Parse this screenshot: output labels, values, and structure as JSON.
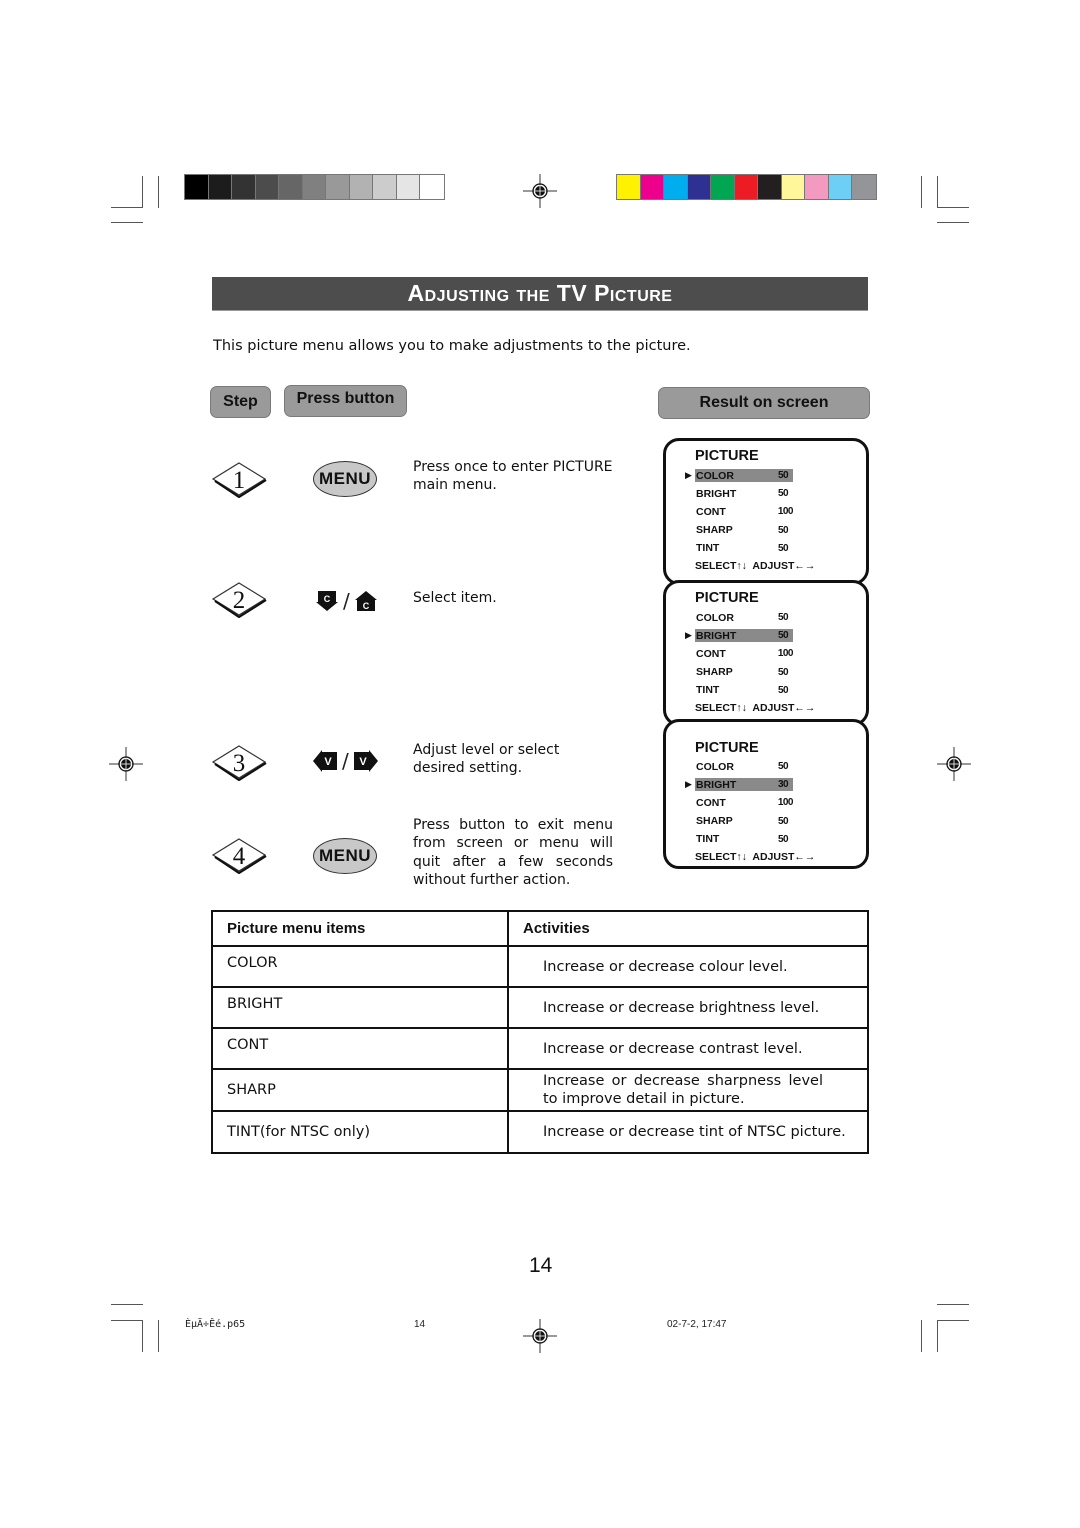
{
  "print_marks": {
    "grayscale_swatches": [
      "#000000",
      "#1c1c1c",
      "#333333",
      "#4c4c4c",
      "#666666",
      "#808080",
      "#999999",
      "#b2b2b2",
      "#cccccc",
      "#e5e5e5",
      "#ffffff"
    ],
    "color_swatches": [
      "#fff200",
      "#ec008c",
      "#00aeef",
      "#2e3192",
      "#00a651",
      "#ed1c24",
      "#231f20",
      "#fff799",
      "#f49ac1",
      "#6dcff6",
      "#939598"
    ]
  },
  "header": {
    "title_parts": [
      {
        "text": "Adjusting the ",
        "small_caps": true
      },
      {
        "text": "TV",
        "small_caps": false
      },
      {
        "text": " Picture",
        "small_caps": true
      }
    ],
    "intro": "This picture menu allows you to make adjustments to the picture."
  },
  "columns": {
    "step": "Step",
    "press_button": "Press button",
    "result": "Result on screen"
  },
  "steps": [
    {
      "number": "1",
      "button": "MENU",
      "button_type": "menu",
      "description": "Press once to enter PICTURE main menu."
    },
    {
      "number": "2",
      "button": "C-down / C-up",
      "button_type": "channel-arrows",
      "icon_letter": "C",
      "separator": "/",
      "description": "Select item."
    },
    {
      "number": "3",
      "button": "V-left / V-right",
      "button_type": "volume-arrows",
      "icon_letter": "V",
      "separator": "/",
      "description": "Adjust level or select desired setting."
    },
    {
      "number": "4",
      "button": "MENU",
      "button_type": "menu",
      "description": "Press button to exit menu from screen or menu will quit after a few seconds without further action."
    }
  ],
  "osd_screens": [
    {
      "title": "PICTURE",
      "selected_index": 0,
      "pointer": "▶",
      "items": [
        {
          "name": "COLOR",
          "value": "50"
        },
        {
          "name": "BRIGHT",
          "value": "50"
        },
        {
          "name": "CONT",
          "value": "100"
        },
        {
          "name": "SHARP",
          "value": "50"
        },
        {
          "name": "TINT",
          "value": "50"
        }
      ],
      "footer": "SELECT↑↓  ADJUST←→"
    },
    {
      "title": "PICTURE",
      "selected_index": 1,
      "pointer": "▶",
      "items": [
        {
          "name": "COLOR",
          "value": "50"
        },
        {
          "name": "BRIGHT",
          "value": "50"
        },
        {
          "name": "CONT",
          "value": "100"
        },
        {
          "name": "SHARP",
          "value": "50"
        },
        {
          "name": "TINT",
          "value": "50"
        }
      ],
      "footer": "SELECT↑↓  ADJUST←→"
    },
    {
      "title": "PICTURE",
      "selected_index": 1,
      "pointer": "▶",
      "items": [
        {
          "name": "COLOR",
          "value": "50"
        },
        {
          "name": "BRIGHT",
          "value": "30"
        },
        {
          "name": "CONT",
          "value": "100"
        },
        {
          "name": "SHARP",
          "value": "50"
        },
        {
          "name": "TINT",
          "value": "50"
        }
      ],
      "footer": "SELECT↑↓  ADJUST←→"
    }
  ],
  "table": {
    "headers": [
      "Picture menu items",
      "Activities"
    ],
    "rows": [
      {
        "item": "COLOR",
        "activity": "Increase or decrease colour level."
      },
      {
        "item": "BRIGHT",
        "activity": "Increase or decrease brightness level."
      },
      {
        "item": "CONT",
        "activity": "Increase or decrease contrast level."
      },
      {
        "item": "SHARP",
        "activity": "Increase or decrease sharpness level to improve detail in picture."
      },
      {
        "item": "TINT(for NTSC only)",
        "activity": "Increase or decrease tint of NTSC picture."
      }
    ]
  },
  "footer": {
    "page_number": "14",
    "slug_file": "ÈµÃ÷Êé.p65",
    "slug_page": "14",
    "slug_date": "02-7-2, 17:47"
  }
}
